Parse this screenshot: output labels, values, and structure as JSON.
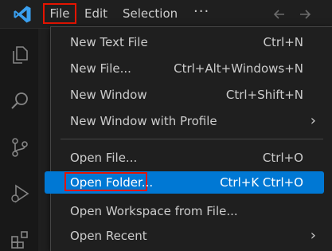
{
  "titlebar": {
    "logo_icon": "vscode-logo-icon",
    "menus": {
      "file": "File",
      "edit": "Edit",
      "selection": "Selection",
      "more": "···"
    },
    "back_icon": "arrow-left-icon",
    "forward_icon": "arrow-right-icon"
  },
  "activitybar": {
    "items": [
      "explorer-icon",
      "search-icon",
      "source-control-icon",
      "run-debug-icon",
      "extensions-icon"
    ]
  },
  "file_menu": {
    "items": [
      {
        "label": "New Text File",
        "shortcut": "Ctrl+N"
      },
      {
        "label": "New File...",
        "shortcut": "Ctrl+Alt+Windows+N"
      },
      {
        "label": "New Window",
        "shortcut": "Ctrl+Shift+N"
      },
      {
        "label": "New Window with Profile",
        "shortcut": "",
        "submenu": true
      },
      {
        "label": "Open File...",
        "shortcut": "Ctrl+O"
      },
      {
        "label": "Open Folder...",
        "shortcut": "Ctrl+K Ctrl+O",
        "highlighted": true
      },
      {
        "label": "Open Workspace from File...",
        "shortcut": ""
      },
      {
        "label": "Open Recent",
        "shortcut": "",
        "submenu": true
      }
    ]
  },
  "colors": {
    "accent": "#0078d4",
    "annotation_red": "#e51400",
    "background": "#1f1f1f"
  }
}
